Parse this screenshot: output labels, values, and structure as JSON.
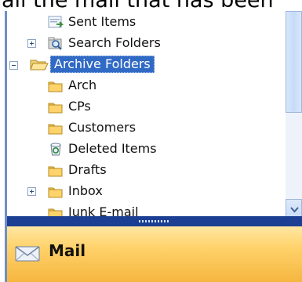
{
  "caption": "all the mail that has been",
  "folders": [
    {
      "label": "Sent Items"
    },
    {
      "label": "Search Folders"
    },
    {
      "label": "Archive Folders"
    },
    {
      "label": "Arch"
    },
    {
      "label": "CPs"
    },
    {
      "label": "Customers"
    },
    {
      "label": "Deleted Items"
    },
    {
      "label": "Drafts"
    },
    {
      "label": "Inbox"
    },
    {
      "label": "Junk E-mail"
    }
  ],
  "nav": {
    "mail_label": "Mail"
  },
  "icons": {
    "folder": "folder-icon",
    "sent": "sent-items-icon",
    "search": "search-folder-icon",
    "archive": "open-folder-icon",
    "deleted": "recycle-bin-icon",
    "mail": "mail-envelope-icon"
  },
  "colors": {
    "selection": "#316ac5",
    "nav_bar": "#ffd26b",
    "splitter": "#1c3f93"
  }
}
